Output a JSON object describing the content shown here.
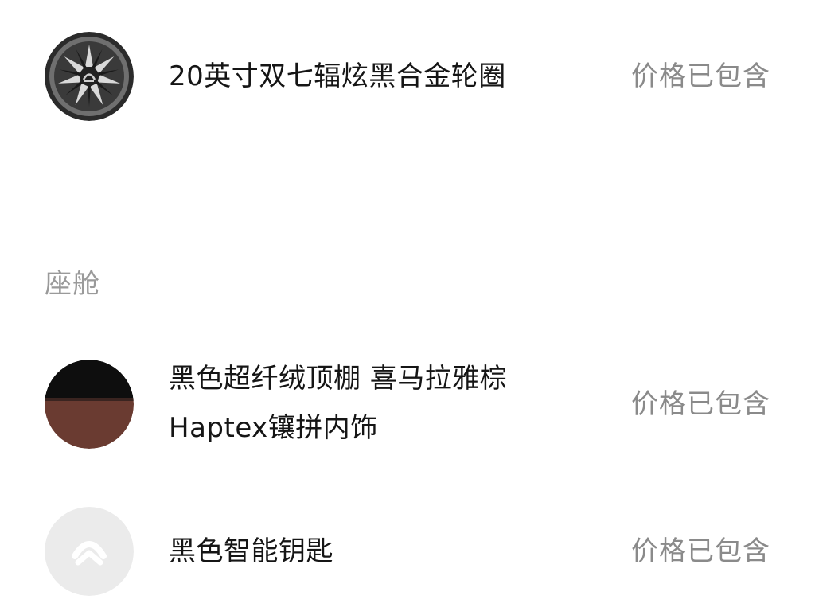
{
  "sections": [
    {
      "title": "",
      "items": [
        {
          "thumbnail_icon": "alloy-wheel-icon",
          "name_line1": "20英寸双七辐炫黑合金轮圈",
          "price_label": "价格已包含"
        }
      ]
    },
    {
      "title": "座舱",
      "items": [
        {
          "thumbnail_icon": "interior-swatch-icon",
          "name_line1": "黑色超纤绒顶棚 喜马拉雅棕",
          "name_line2": "Haptex镶拼内饰",
          "price_label": "价格已包含",
          "colors": {
            "top": "#0e0e0e",
            "bottom": "#6a3b31"
          }
        },
        {
          "thumbnail_icon": "smart-key-icon",
          "name_line1": "黑色智能钥匙",
          "price_label": "价格已包含"
        }
      ]
    }
  ],
  "colors": {
    "primary_text": "#151515",
    "secondary_text": "#8a8a8a",
    "section_title": "#9a9a9a",
    "background": "#ffffff"
  }
}
